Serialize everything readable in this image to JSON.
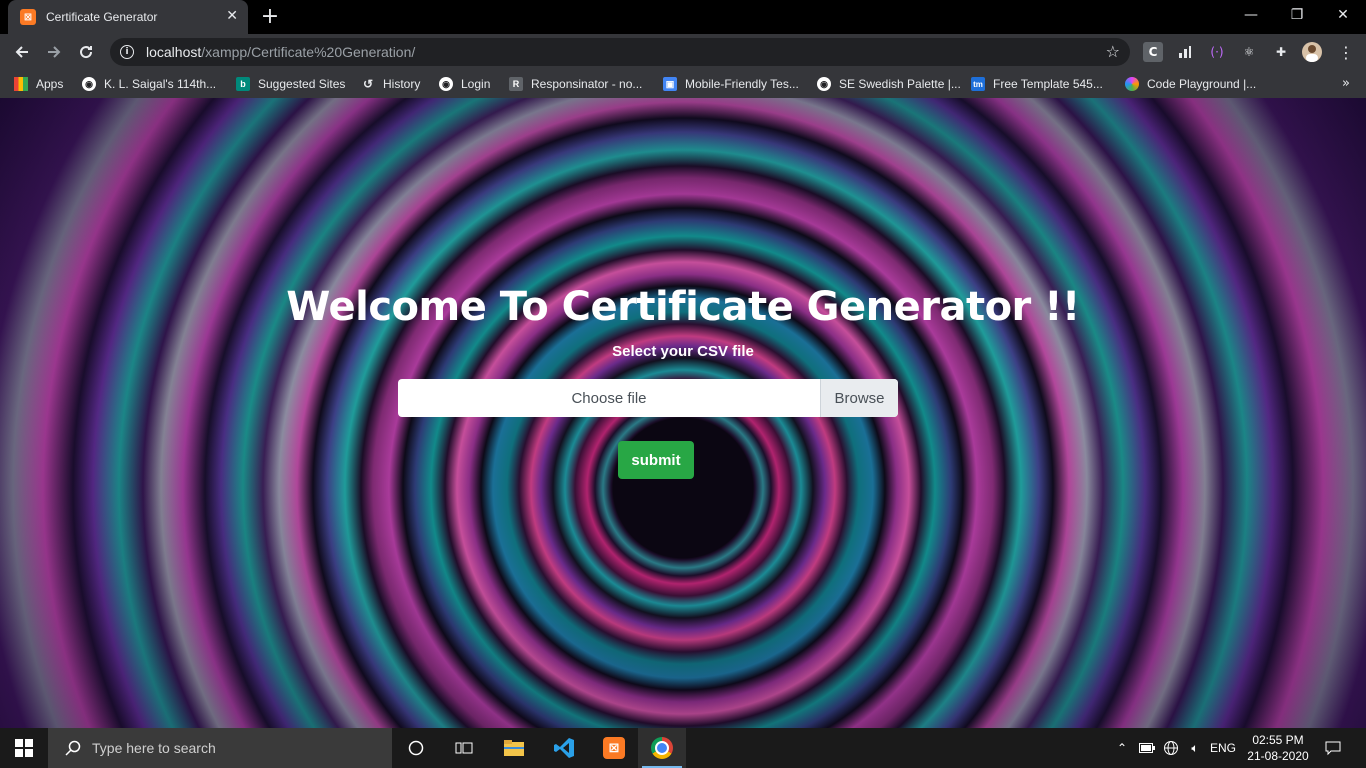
{
  "browser": {
    "tab": {
      "title": "Certificate Generator",
      "favicon": "xampp-icon"
    },
    "address": {
      "host": "localhost",
      "path": "/xampp/Certificate%20Generation/"
    },
    "extensions": [
      "c-extension-icon",
      "stats-extension-icon",
      "api-extension-icon",
      "react-devtools-icon",
      "puzzle-icon",
      "profile-avatar"
    ]
  },
  "bookmarks": [
    {
      "label": "Apps",
      "icon": "apps-grid-icon",
      "color": "#ea4335"
    },
    {
      "label": "K. L. Saigal's 114th...",
      "icon": "globe-icon",
      "color": "#ffffff"
    },
    {
      "label": "Suggested Sites",
      "icon": "bing-icon",
      "color": "#00897b"
    },
    {
      "label": "History",
      "icon": "history-icon",
      "color": "#ffffff"
    },
    {
      "label": "Login",
      "icon": "globe-icon",
      "color": "#ffffff"
    },
    {
      "label": "Responsinator - no...",
      "icon": "r-icon",
      "color": "#9aa0a6"
    },
    {
      "label": "Mobile-Friendly Tes...",
      "icon": "mobile-test-icon",
      "color": "#4285f4"
    },
    {
      "label": "SE Swedish Palette |...",
      "icon": "globe-icon",
      "color": "#ffffff"
    },
    {
      "label": "Free Template 545...",
      "icon": "tm-icon",
      "color": "#1e6fd9"
    },
    {
      "label": "Code Playground |...",
      "icon": "code-playground-icon",
      "color": "#e040fb"
    }
  ],
  "page": {
    "title": "Welcome To Certificate Generator !!",
    "subtitle": "Select your CSV file",
    "file_input": {
      "placeholder": "Choose file",
      "button": "Browse"
    },
    "submit_label": "submit",
    "accent": "#28a745"
  },
  "taskbar": {
    "search_placeholder": "Type here to search",
    "apps": [
      "cortana-icon",
      "task-view-icon",
      "file-explorer-icon",
      "vscode-icon",
      "xampp-icon",
      "chrome-icon"
    ],
    "language": "ENG",
    "time": "02:55 PM",
    "date": "21-08-2020"
  }
}
